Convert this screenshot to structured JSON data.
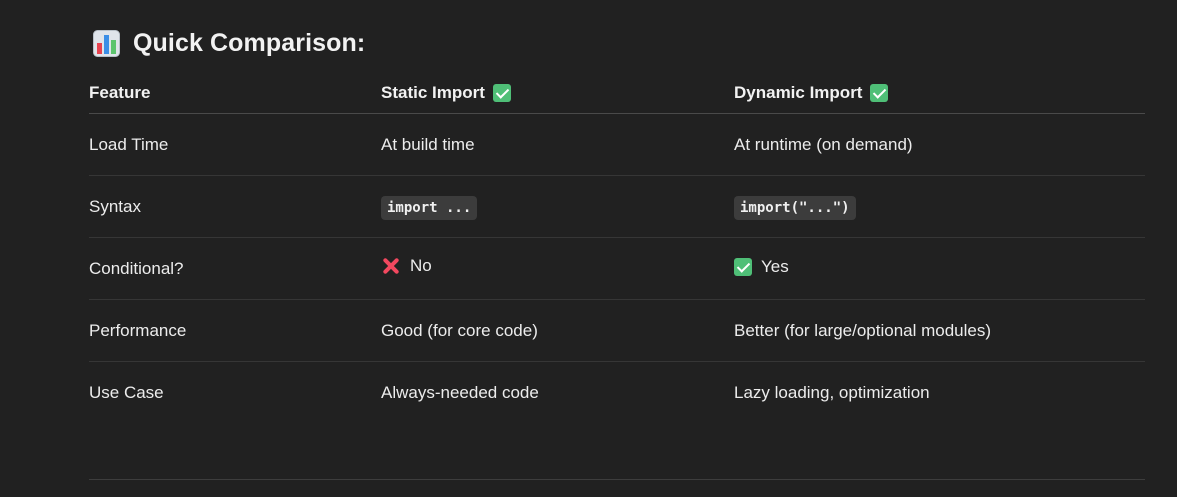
{
  "heading": {
    "icon": "bar-chart-icon",
    "title": "Quick Comparison:"
  },
  "table": {
    "headers": {
      "feature": "Feature",
      "static": "Static Import",
      "dynamic": "Dynamic Import",
      "header_icon": "check-mark-icon"
    },
    "rows": [
      {
        "feature": "Load Time",
        "static": "At build time",
        "dynamic": "At runtime (on demand)"
      },
      {
        "feature": "Syntax",
        "static": "import ...",
        "dynamic": "import(\"...\")"
      },
      {
        "feature": "Conditional?",
        "static": "No",
        "static_icon": "cross-mark-icon",
        "dynamic": "Yes",
        "dynamic_icon": "check-mark-icon"
      },
      {
        "feature": "Performance",
        "static": "Good (for core code)",
        "dynamic": "Better (for large/optional modules)"
      },
      {
        "feature": "Use Case",
        "static": "Always-needed code",
        "dynamic": "Lazy loading, optimization"
      }
    ]
  },
  "colors": {
    "background": "#212121",
    "check": "#4fbf77",
    "cross": "#f2485f",
    "code_bg": "#3c3c3c"
  }
}
